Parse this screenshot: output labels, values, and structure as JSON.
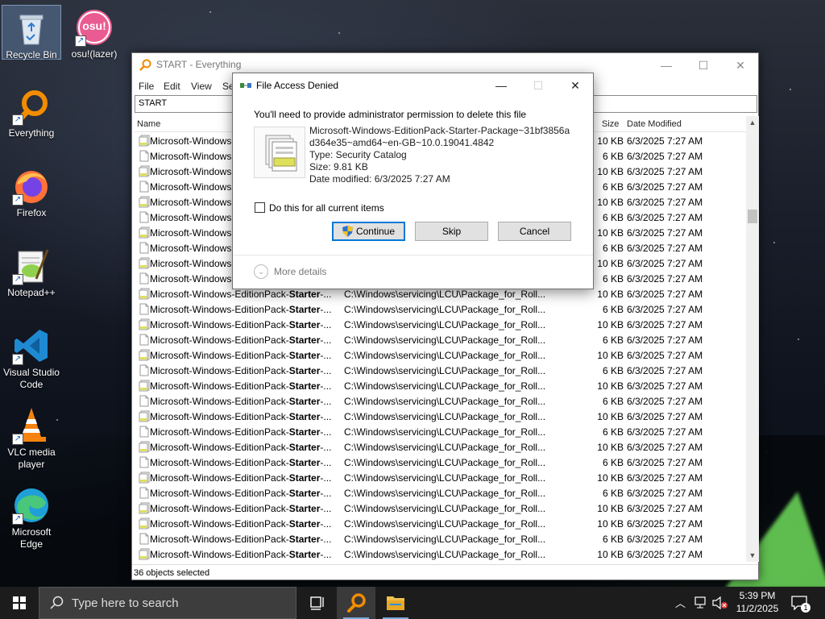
{
  "desktop": {
    "icons": [
      {
        "label": "Recycle Bin"
      },
      {
        "label": "osu!(lazer)",
        "badge": "osu!"
      },
      {
        "label": "Everything"
      },
      {
        "label": "Firefox"
      },
      {
        "label": "Notepad++"
      },
      {
        "label": "Visual Studio Code"
      },
      {
        "label": "VLC media player"
      },
      {
        "label": "Microsoft Edge"
      }
    ]
  },
  "everything_window": {
    "title": "START - Everything",
    "menu": [
      "File",
      "Edit",
      "View",
      "Se"
    ],
    "search_value": "START",
    "columns": {
      "name": "Name",
      "size": "Size",
      "date": "Date Modified"
    },
    "status": "36 objects selected",
    "rows": [
      {
        "name_prefix": "Microsoft-Windows",
        "name_bold": "",
        "name_suffix": "",
        "path": "",
        "size": "10 KB",
        "date": "6/3/2025 7:27 AM",
        "icon": "catalog"
      },
      {
        "name_prefix": "Microsoft-Windows",
        "name_bold": "",
        "name_suffix": "",
        "path": "",
        "size": "6 KB",
        "date": "6/3/2025 7:27 AM",
        "icon": "doc"
      },
      {
        "name_prefix": "Microsoft-Windows",
        "name_bold": "",
        "name_suffix": "",
        "path": "",
        "size": "10 KB",
        "date": "6/3/2025 7:27 AM",
        "icon": "catalog"
      },
      {
        "name_prefix": "Microsoft-Windows",
        "name_bold": "",
        "name_suffix": "",
        "path": "",
        "size": "6 KB",
        "date": "6/3/2025 7:27 AM",
        "icon": "doc"
      },
      {
        "name_prefix": "Microsoft-Windows",
        "name_bold": "",
        "name_suffix": "",
        "path": "",
        "size": "10 KB",
        "date": "6/3/2025 7:27 AM",
        "icon": "catalog"
      },
      {
        "name_prefix": "Microsoft-Windows",
        "name_bold": "",
        "name_suffix": "",
        "path": "",
        "size": "6 KB",
        "date": "6/3/2025 7:27 AM",
        "icon": "doc"
      },
      {
        "name_prefix": "Microsoft-Windows",
        "name_bold": "",
        "name_suffix": "",
        "path": "",
        "size": "10 KB",
        "date": "6/3/2025 7:27 AM",
        "icon": "catalog"
      },
      {
        "name_prefix": "Microsoft-Windows",
        "name_bold": "",
        "name_suffix": "",
        "path": "",
        "size": "6 KB",
        "date": "6/3/2025 7:27 AM",
        "icon": "doc"
      },
      {
        "name_prefix": "Microsoft-Windows",
        "name_bold": "",
        "name_suffix": "",
        "path": "",
        "size": "10 KB",
        "date": "6/3/2025 7:27 AM",
        "icon": "catalog"
      },
      {
        "name_prefix": "Microsoft-Windows",
        "name_bold": "",
        "name_suffix": "",
        "path": "",
        "size": "6 KB",
        "date": "6/3/2025 7:27 AM",
        "icon": "doc"
      },
      {
        "name_prefix": "Microsoft-Windows-EditionPack-",
        "name_bold": "Starter",
        "name_suffix": "-...",
        "path": "C:\\Windows\\servicing\\LCU\\Package_for_Roll...",
        "size": "10 KB",
        "date": "6/3/2025 7:27 AM",
        "icon": "catalog"
      },
      {
        "name_prefix": "Microsoft-Windows-EditionPack-",
        "name_bold": "Starter",
        "name_suffix": "-...",
        "path": "C:\\Windows\\servicing\\LCU\\Package_for_Roll...",
        "size": "6 KB",
        "date": "6/3/2025 7:27 AM",
        "icon": "doc"
      },
      {
        "name_prefix": "Microsoft-Windows-EditionPack-",
        "name_bold": "Starter",
        "name_suffix": "-...",
        "path": "C:\\Windows\\servicing\\LCU\\Package_for_Roll...",
        "size": "10 KB",
        "date": "6/3/2025 7:27 AM",
        "icon": "catalog"
      },
      {
        "name_prefix": "Microsoft-Windows-EditionPack-",
        "name_bold": "Starter",
        "name_suffix": "-...",
        "path": "C:\\Windows\\servicing\\LCU\\Package_for_Roll...",
        "size": "6 KB",
        "date": "6/3/2025 7:27 AM",
        "icon": "doc"
      },
      {
        "name_prefix": "Microsoft-Windows-EditionPack-",
        "name_bold": "Starter",
        "name_suffix": "-...",
        "path": "C:\\Windows\\servicing\\LCU\\Package_for_Roll...",
        "size": "10 KB",
        "date": "6/3/2025 7:27 AM",
        "icon": "catalog"
      },
      {
        "name_prefix": "Microsoft-Windows-EditionPack-",
        "name_bold": "Starter",
        "name_suffix": "-...",
        "path": "C:\\Windows\\servicing\\LCU\\Package_for_Roll...",
        "size": "6 KB",
        "date": "6/3/2025 7:27 AM",
        "icon": "doc"
      },
      {
        "name_prefix": "Microsoft-Windows-EditionPack-",
        "name_bold": "Starter",
        "name_suffix": "-...",
        "path": "C:\\Windows\\servicing\\LCU\\Package_for_Roll...",
        "size": "10 KB",
        "date": "6/3/2025 7:27 AM",
        "icon": "catalog"
      },
      {
        "name_prefix": "Microsoft-Windows-EditionPack-",
        "name_bold": "Starter",
        "name_suffix": "-...",
        "path": "C:\\Windows\\servicing\\LCU\\Package_for_Roll...",
        "size": "6 KB",
        "date": "6/3/2025 7:27 AM",
        "icon": "doc"
      },
      {
        "name_prefix": "Microsoft-Windows-EditionPack-",
        "name_bold": "Starter",
        "name_suffix": "-...",
        "path": "C:\\Windows\\servicing\\LCU\\Package_for_Roll...",
        "size": "10 KB",
        "date": "6/3/2025 7:27 AM",
        "icon": "catalog"
      },
      {
        "name_prefix": "Microsoft-Windows-EditionPack-",
        "name_bold": "Starter",
        "name_suffix": "-...",
        "path": "C:\\Windows\\servicing\\LCU\\Package_for_Roll...",
        "size": "6 KB",
        "date": "6/3/2025 7:27 AM",
        "icon": "doc"
      },
      {
        "name_prefix": "Microsoft-Windows-EditionPack-",
        "name_bold": "Starter",
        "name_suffix": "-...",
        "path": "C:\\Windows\\servicing\\LCU\\Package_for_Roll...",
        "size": "10 KB",
        "date": "6/3/2025 7:27 AM",
        "icon": "catalog"
      },
      {
        "name_prefix": "Microsoft-Windows-EditionPack-",
        "name_bold": "Starter",
        "name_suffix": "-...",
        "path": "C:\\Windows\\servicing\\LCU\\Package_for_Roll...",
        "size": "6 KB",
        "date": "6/3/2025 7:27 AM",
        "icon": "doc"
      },
      {
        "name_prefix": "Microsoft-Windows-EditionPack-",
        "name_bold": "Starter",
        "name_suffix": "-...",
        "path": "C:\\Windows\\servicing\\LCU\\Package_for_Roll...",
        "size": "10 KB",
        "date": "6/3/2025 7:27 AM",
        "icon": "catalog"
      },
      {
        "name_prefix": "Microsoft-Windows-EditionPack-",
        "name_bold": "Starter",
        "name_suffix": "-...",
        "path": "C:\\Windows\\servicing\\LCU\\Package_for_Roll...",
        "size": "6 KB",
        "date": "6/3/2025 7:27 AM",
        "icon": "doc"
      },
      {
        "name_prefix": "Microsoft-Windows-EditionPack-",
        "name_bold": "Starter",
        "name_suffix": "-...",
        "path": "C:\\Windows\\servicing\\LCU\\Package_for_Roll...",
        "size": "10 KB",
        "date": "6/3/2025 7:27 AM",
        "icon": "catalog"
      },
      {
        "name_prefix": "Microsoft-Windows-EditionPack-",
        "name_bold": "Starter",
        "name_suffix": "-...",
        "path": "C:\\Windows\\servicing\\LCU\\Package_for_Roll...",
        "size": "10 KB",
        "date": "6/3/2025 7:27 AM",
        "icon": "catalog"
      },
      {
        "name_prefix": "Microsoft-Windows-EditionPack-",
        "name_bold": "Starter",
        "name_suffix": "-...",
        "path": "C:\\Windows\\servicing\\LCU\\Package_for_Roll...",
        "size": "6 KB",
        "date": "6/3/2025 7:27 AM",
        "icon": "doc"
      },
      {
        "name_prefix": "Microsoft-Windows-EditionPack-",
        "name_bold": "Starter",
        "name_suffix": "-...",
        "path": "C:\\Windows\\servicing\\LCU\\Package_for_Roll...",
        "size": "10 KB",
        "date": "6/3/2025 7:27 AM",
        "icon": "catalog"
      },
      {
        "name_prefix": "Microsoft-Windows-EditionPack-",
        "name_bold": "Starter",
        "name_suffix": "-...",
        "path": "C:\\Windows\\servicing\\LCU\\Package_for_Roll...",
        "size": "6 KB",
        "date": "6/3/2025 7:27 AM",
        "icon": "doc"
      }
    ]
  },
  "dialog": {
    "title": "File Access Denied",
    "message": "You'll need to provide administrator permission to delete this file",
    "file_name_line1": "Microsoft-Windows-EditionPack-Starter-Package~31bf3856a",
    "file_name_line2": "d364e35~amd64~en-GB~10.0.19041.4842",
    "type": "Type: Security Catalog",
    "size": "Size: 9.81 KB",
    "date_modified": "Date modified: 6/3/2025 7:27 AM",
    "checkbox_label": "Do this for all current items",
    "checkbox_checked": false,
    "buttons": {
      "continue": "Continue",
      "skip": "Skip",
      "cancel": "Cancel"
    },
    "more_details": "More details"
  },
  "taskbar": {
    "search_placeholder": "Type here to search",
    "time": "5:39 PM",
    "date": "11/2/2025",
    "notification_count": "1"
  },
  "colors": {
    "accent": "#0078d7",
    "taskbar": "#1c1c1c",
    "everything_orange": "#f28c00"
  }
}
